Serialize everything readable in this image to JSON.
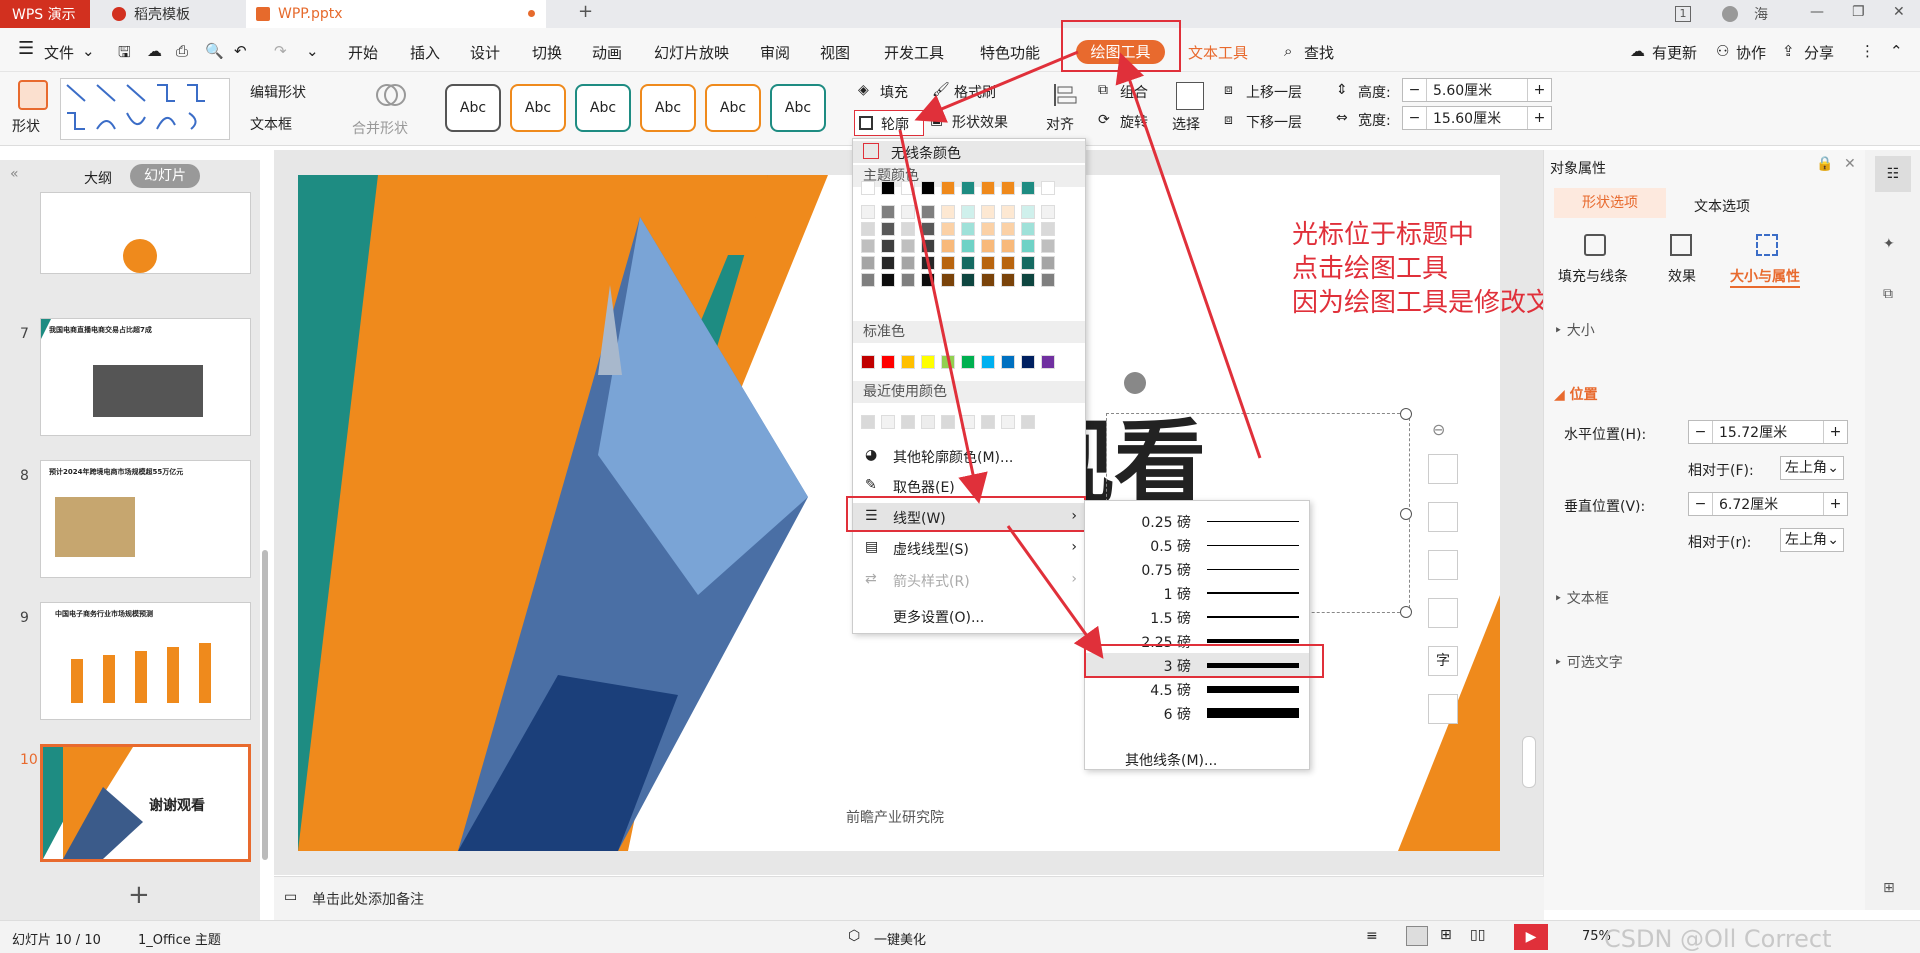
{
  "titlebar": {
    "app": "WPS 演示",
    "template_tab": "稻壳模板",
    "file_tab": "WPP.pptx",
    "badge": "1",
    "user": "海"
  },
  "menubar": {
    "file": "文件",
    "items": [
      "开始",
      "插入",
      "设计",
      "切换",
      "动画",
      "幻灯片放映",
      "审阅",
      "视图",
      "开发工具",
      "特色功能"
    ],
    "draw_tools": "绘图工具",
    "text_tools": "文本工具",
    "search": "查找",
    "update": "有更新",
    "collab": "协作",
    "share": "分享"
  },
  "ribbon": {
    "shape": "形状",
    "edit_shape": "编辑形状",
    "textbox": "文本框",
    "merge_shape": "合并形状",
    "styles": [
      "Abc",
      "Abc",
      "Abc",
      "Abc",
      "Abc",
      "Abc"
    ],
    "fill": "填充",
    "format_painter": "格式刷",
    "outline": "轮廓",
    "shape_effect": "形状效果",
    "align": "对齐",
    "group": "组合",
    "rotate": "旋转",
    "select": "选择",
    "bring_forward": "上移一层",
    "send_backward": "下移一层",
    "height_label": "高度:",
    "height_value": "5.60厘米",
    "width_label": "宽度:",
    "width_value": "15.60厘米"
  },
  "leftpanel": {
    "outline_tab": "大纲",
    "slides_tab": "幻灯片",
    "slide_numbers": [
      "7",
      "8",
      "9",
      "10"
    ],
    "thumb_titles": [
      "我国电商直播电商交易占比超7成",
      "预计2024年跨境电商市场规模超55万亿元",
      "中国电子商务行业市场规模预测",
      "谢谢观看"
    ]
  },
  "dropdown": {
    "no_line": "无线条颜色",
    "theme_colors": "主题颜色",
    "standard_colors": "标准色",
    "recent_colors": "最近使用颜色",
    "more_colors": "其他轮廓颜色(M)...",
    "eyedropper": "取色器(E)",
    "line_type": "线型(W)",
    "dash_type": "虚线线型(S)",
    "arrow_style": "箭头样式(R)",
    "more_settings": "更多设置(O)..."
  },
  "submenu": {
    "items": [
      {
        "label": "0.25 磅",
        "w": 0.25
      },
      {
        "label": "0.5 磅",
        "w": 0.5
      },
      {
        "label": "0.75 磅",
        "w": 0.75
      },
      {
        "label": "1 磅",
        "w": 1
      },
      {
        "label": "1.5 磅",
        "w": 1.5
      },
      {
        "label": "2.25 磅",
        "w": 2.25
      },
      {
        "label": "3 磅",
        "w": 3
      },
      {
        "label": "4.5 磅",
        "w": 4.5
      },
      {
        "label": "6 磅",
        "w": 6
      }
    ],
    "more": "其他线条(M)..."
  },
  "slide": {
    "title_fragment": "射观看",
    "footer": "前瞻产业研究院"
  },
  "annotation": {
    "line1": "光标位于标题中",
    "line2": "点击绘图工具",
    "line3": "因为绘图工具是修改文本框样式"
  },
  "rightpanel": {
    "title": "对象属性",
    "tab_shape": "形状选项",
    "tab_text": "文本选项",
    "sub_fill": "填充与线条",
    "sub_effect": "效果",
    "sub_size": "大小与属性",
    "size": "大小",
    "position": "位置",
    "h_pos_label": "水平位置(H):",
    "h_pos_value": "15.72厘米",
    "rel_f_label": "相对于(F):",
    "rel_f_value": "左上角",
    "v_pos_label": "垂直位置(V):",
    "v_pos_value": "6.72厘米",
    "rel_r_label": "相对于(r):",
    "rel_r_value": "左上角",
    "textbox": "文本框",
    "alt_text": "可选文字"
  },
  "notes": {
    "placeholder": "单击此处添加备注"
  },
  "status": {
    "slide_info": "幻灯片 10 / 10",
    "theme": "1_Office 主题",
    "beautify": "一键美化",
    "zoom": "75%",
    "watermark": "CSDN @Oll Correct"
  },
  "colors": {
    "accent": "#e86a2e",
    "teal": "#1e8c82",
    "orange": "#ef8a1c",
    "red": "#e0303a"
  }
}
